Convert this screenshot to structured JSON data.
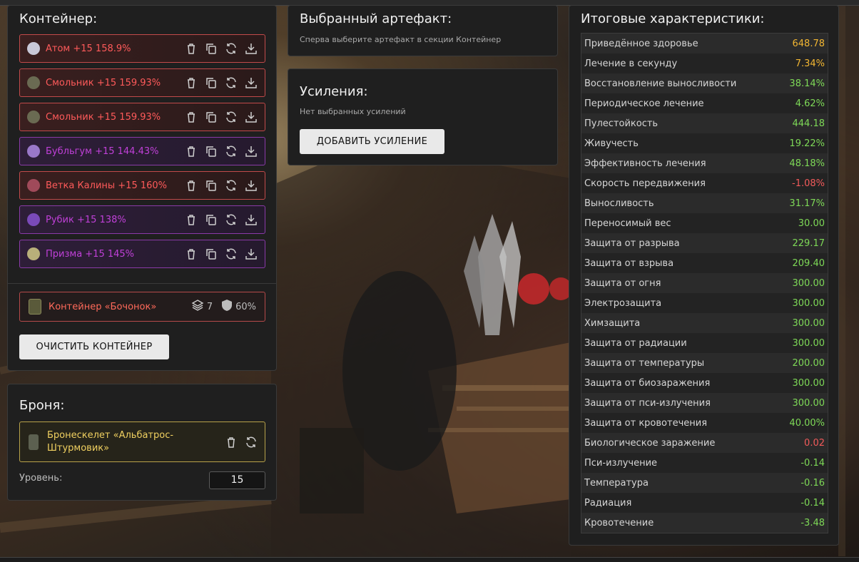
{
  "container_panel": {
    "title": "Контейнер:",
    "artifacts": [
      {
        "label": "Атом +15 158.9%",
        "style": "red",
        "icon": "atom-artifact-icon",
        "icon_color": "#c8c8d8"
      },
      {
        "label": "Смольник +15 159.93%",
        "style": "red",
        "icon": "smolnik-artifact-icon",
        "icon_color": "#6a6a52"
      },
      {
        "label": "Смольник +15 159.93%",
        "style": "red",
        "icon": "smolnik-artifact-icon",
        "icon_color": "#6a6a52"
      },
      {
        "label": "Бубльгум +15 144.43%",
        "style": "purple",
        "icon": "bubblegum-artifact-icon",
        "icon_color": "#9a78c8"
      },
      {
        "label": "Ветка Калины +15 160%",
        "style": "red",
        "icon": "kalina-branch-artifact-icon",
        "icon_color": "#a04a5a"
      },
      {
        "label": "Рубик +15 138%",
        "style": "purple",
        "icon": "rubik-artifact-icon",
        "icon_color": "#7a4ab8"
      },
      {
        "label": "Призма +15 145%",
        "style": "purple",
        "icon": "prism-artifact-icon",
        "icon_color": "#b8b07a"
      }
    ],
    "container": {
      "label": "Контейнер «Бочонок»",
      "slots": "7",
      "protection": "60%"
    },
    "clear_button": "ОЧИСТИТЬ КОНТЕЙНЕР"
  },
  "armor_panel": {
    "title": "Броня:",
    "armor_label": "Бронескелет «Альбатрос-Штурмовик»",
    "level_label": "Уровень:",
    "level_value": "15"
  },
  "selected_panel": {
    "title": "Выбранный артефакт:",
    "hint": "Сперва выберите артефакт в секции Контейнер"
  },
  "boosts_panel": {
    "title": "Усиления:",
    "empty_text": "Нет выбранных усилений",
    "add_button": "ДОБАВИТЬ УСИЛЕНИЕ"
  },
  "stats_panel": {
    "title": "Итоговые характеристики:",
    "rows": [
      {
        "name": "Приведённое здоровье",
        "value": "648.78",
        "tone": "gold"
      },
      {
        "name": "Лечение в секунду",
        "value": "7.34%",
        "tone": "gold"
      },
      {
        "name": "Восстановление выносливости",
        "value": "38.14%",
        "tone": "green"
      },
      {
        "name": "Периодическое лечение",
        "value": "4.62%",
        "tone": "green"
      },
      {
        "name": "Пулестойкость",
        "value": "444.18",
        "tone": "green"
      },
      {
        "name": "Живучесть",
        "value": "19.22%",
        "tone": "green"
      },
      {
        "name": "Эффективность лечения",
        "value": "48.18%",
        "tone": "green"
      },
      {
        "name": "Скорость передвижения",
        "value": "-1.08%",
        "tone": "red"
      },
      {
        "name": "Выносливость",
        "value": "31.17%",
        "tone": "green"
      },
      {
        "name": "Переносимый вес",
        "value": "30.00",
        "tone": "green"
      },
      {
        "name": "Защита от разрыва",
        "value": "229.17",
        "tone": "green"
      },
      {
        "name": "Защита от взрыва",
        "value": "209.40",
        "tone": "green"
      },
      {
        "name": "Защита от огня",
        "value": "300.00",
        "tone": "green"
      },
      {
        "name": "Электрозащита",
        "value": "300.00",
        "tone": "green"
      },
      {
        "name": "Химзащита",
        "value": "300.00",
        "tone": "green"
      },
      {
        "name": "Защита от радиации",
        "value": "300.00",
        "tone": "green"
      },
      {
        "name": "Защита от температуры",
        "value": "200.00",
        "tone": "green"
      },
      {
        "name": "Защита от биозаражения",
        "value": "300.00",
        "tone": "green"
      },
      {
        "name": "Защита от пси-излучения",
        "value": "300.00",
        "tone": "green"
      },
      {
        "name": "Защита от кровотечения",
        "value": "40.00%",
        "tone": "green"
      },
      {
        "name": "Биологическое заражение",
        "value": "0.02",
        "tone": "red"
      },
      {
        "name": "Пси-излучение",
        "value": "-0.14",
        "tone": "green"
      },
      {
        "name": "Температура",
        "value": "-0.16",
        "tone": "green"
      },
      {
        "name": "Радиация",
        "value": "-0.14",
        "tone": "green"
      },
      {
        "name": "Кровотечение",
        "value": "-3.48",
        "tone": "green"
      }
    ]
  },
  "colors": {
    "positive": "#7ed957",
    "highlight": "#f2b632",
    "negative": "#f25a5a",
    "artifact_red_border": "#c24a4a",
    "artifact_purple_border": "#8a3aa8",
    "armor_border": "#b8a24a",
    "armor_text": "#f0d060"
  }
}
